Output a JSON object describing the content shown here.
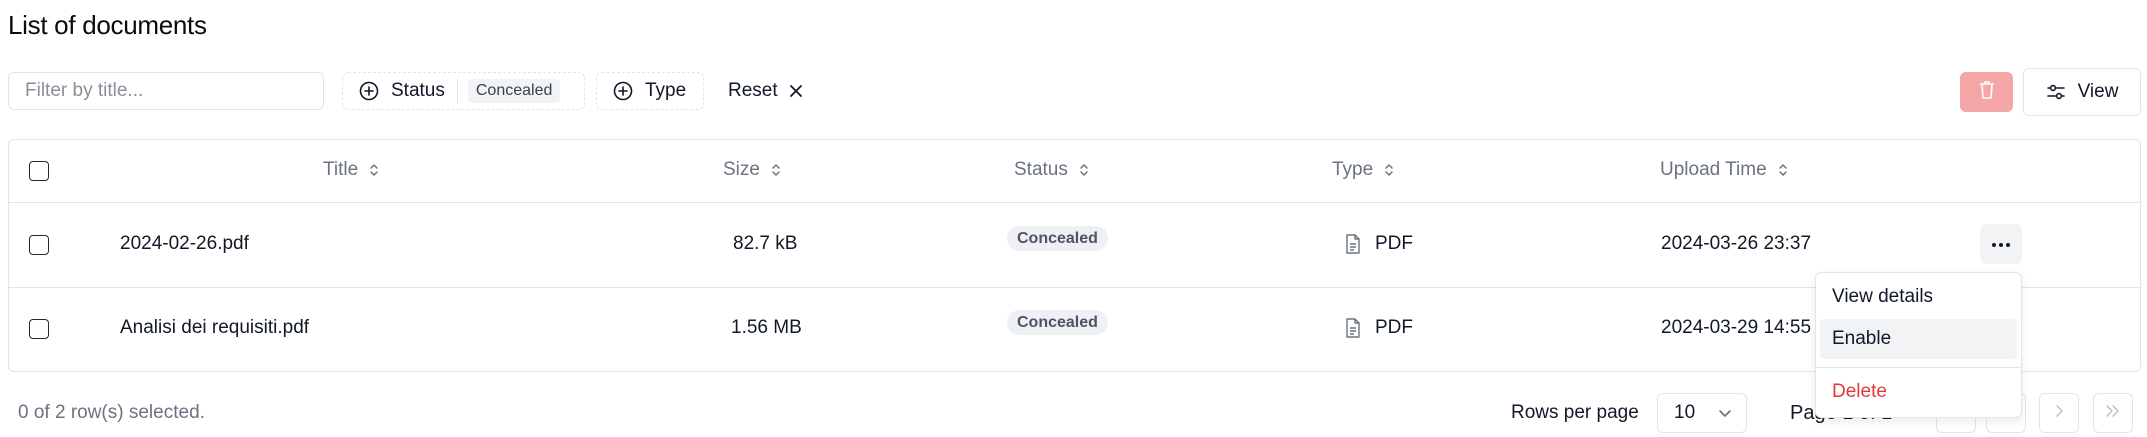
{
  "page": {
    "title": "List of documents"
  },
  "toolbar": {
    "filter_placeholder": "Filter by title...",
    "status_filter_label": "Status",
    "status_filter_value": "Concealed",
    "type_filter_label": "Type",
    "reset_label": "Reset",
    "view_label": "View",
    "delete_color": "#f4a6a6"
  },
  "table": {
    "columns": [
      "Title",
      "Size",
      "Status",
      "Type",
      "Upload Time"
    ],
    "rows": [
      {
        "title": "2024-02-26.pdf",
        "size": "82.7 kB",
        "status": "Concealed",
        "type": "PDF",
        "upload_time": "2024-03-26 23:37"
      },
      {
        "title": "Analisi dei requisiti.pdf",
        "size": "1.56 MB",
        "status": "Concealed",
        "type": "PDF",
        "upload_time": "2024-03-29 14:55"
      }
    ]
  },
  "row_menu": {
    "items": [
      "View details",
      "Enable",
      "Delete"
    ],
    "highlighted": "Enable",
    "danger_color": "#e53935"
  },
  "footer": {
    "selection_text": "0 of 2 row(s) selected.",
    "rows_per_page_label": "Rows per page",
    "rows_per_page_value": "10",
    "page_label": "Page 1 of 1"
  }
}
